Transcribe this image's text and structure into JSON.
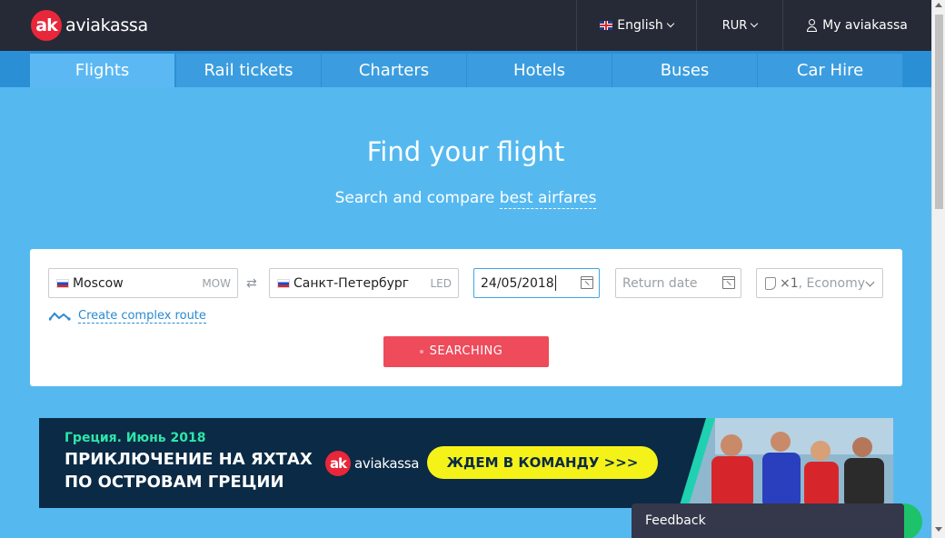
{
  "header": {
    "logo_mark": "ak",
    "logo_text": "aviakassa",
    "language": "English",
    "currency": "RUR",
    "account": "My aviakassa"
  },
  "nav": {
    "tabs": [
      {
        "label": "Flights",
        "active": true
      },
      {
        "label": "Rail tickets",
        "active": false
      },
      {
        "label": "Charters",
        "active": false
      },
      {
        "label": "Hotels",
        "active": false
      },
      {
        "label": "Buses",
        "active": false
      },
      {
        "label": "Car Hire",
        "active": false
      }
    ]
  },
  "hero": {
    "title": "Find your flight",
    "subtitle_prefix": "Search and compare ",
    "subtitle_link": "best airfares"
  },
  "search": {
    "from": {
      "city": "Moscow",
      "code": "MOW"
    },
    "to": {
      "city": "Санкт-Петербург",
      "code": "LED"
    },
    "depart_date": "24/05/2018",
    "return_placeholder": "Return date",
    "passengers": "×1",
    "cabin_class": ", Economy",
    "complex_route": "Create complex route",
    "submit": "SEARCHING"
  },
  "banner": {
    "small": "Греция. Июнь 2018",
    "line1": "ПРИКЛЮЧЕНИЕ НА ЯХТАХ",
    "line2": "ПО ОСТРОВАМ ГРЕЦИИ",
    "logo_text": "aviakassa",
    "cta": "ЖДЕМ В КОМАНДУ >>>"
  },
  "feedback": {
    "label": "Feedback"
  },
  "colors": {
    "accent": "#ee4b5b",
    "header_bg": "#262a36",
    "page_bg": "#55b9f0",
    "nav_bg": "#2b8fd6",
    "banner_bg": "#0a2a45",
    "cta_yellow": "#f5f21a"
  }
}
